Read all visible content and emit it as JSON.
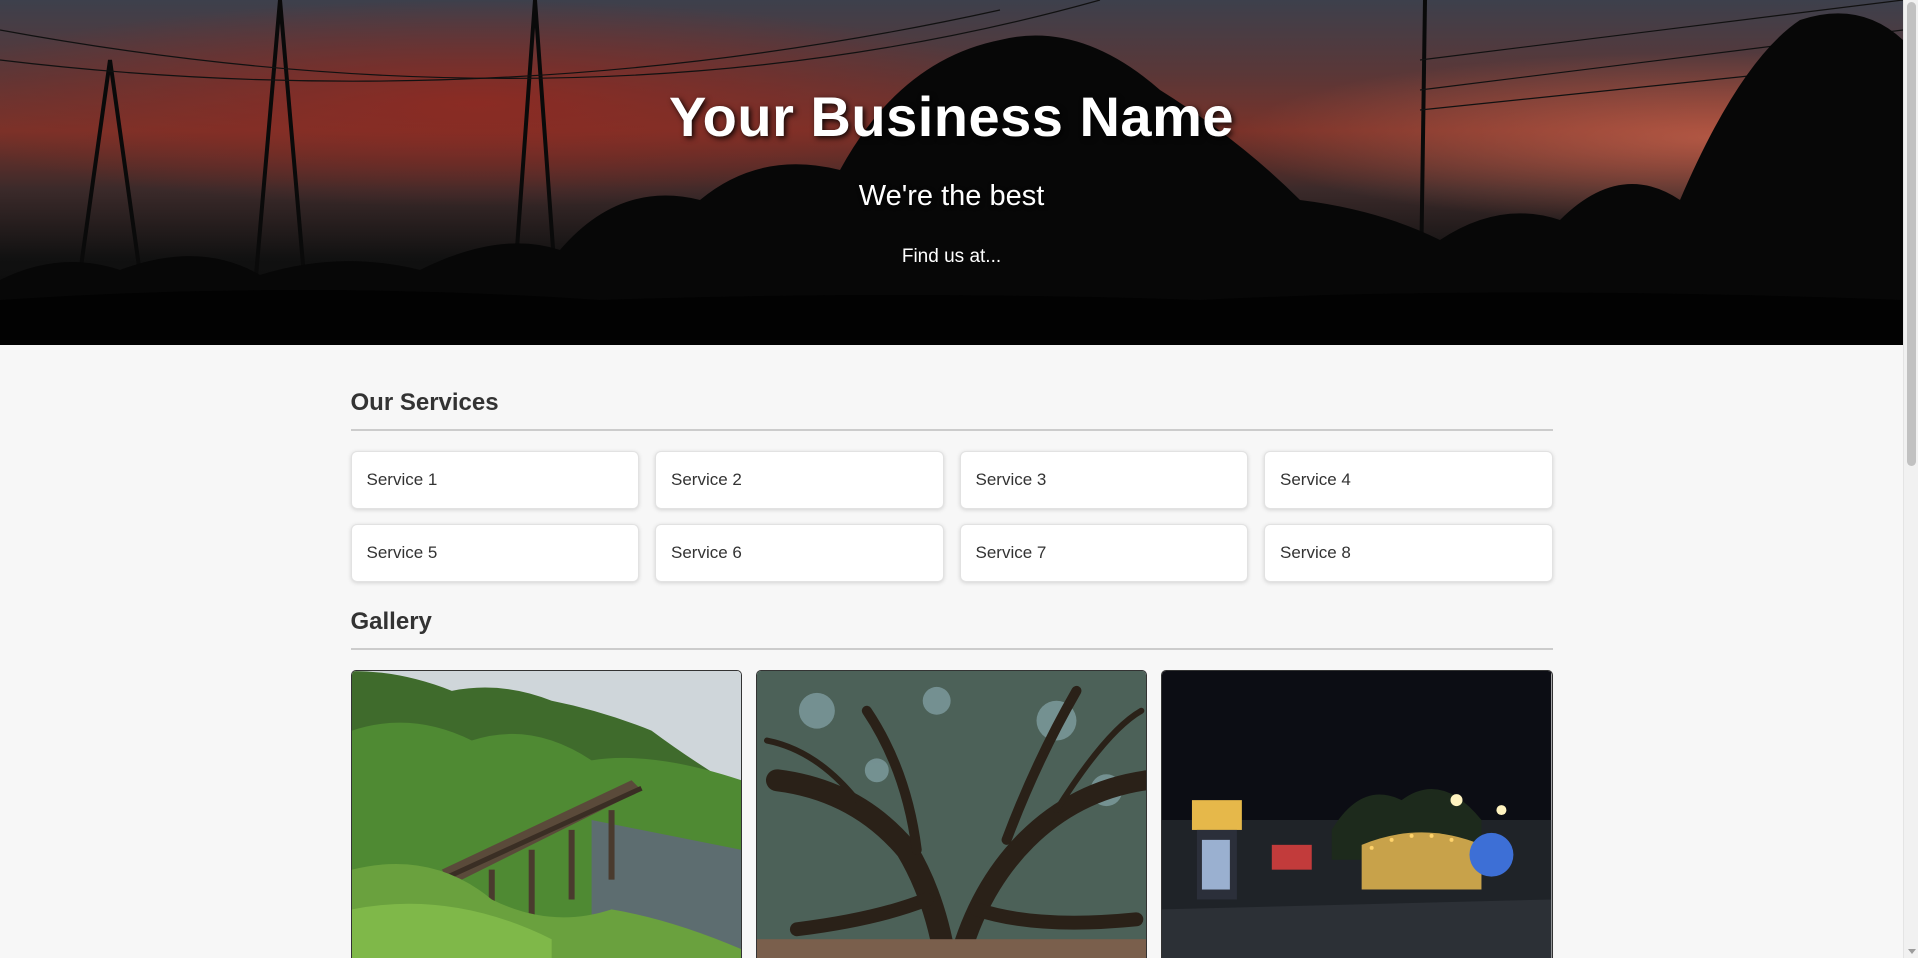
{
  "hero": {
    "title": "Your Business Name",
    "tagline": "We're the best",
    "find_link": "Find us at..."
  },
  "services": {
    "heading": "Our Services",
    "items": [
      "Service 1",
      "Service 2",
      "Service 3",
      "Service 4",
      "Service 5",
      "Service 6",
      "Service 7",
      "Service 8"
    ]
  },
  "gallery": {
    "heading": "Gallery",
    "images": [
      "rail-bridge-photo",
      "oak-tree-photo",
      "night-carnival-photo"
    ]
  },
  "colors": {
    "page_background": "#f7f7f7",
    "text": "#333333",
    "card_background": "#ffffff"
  }
}
